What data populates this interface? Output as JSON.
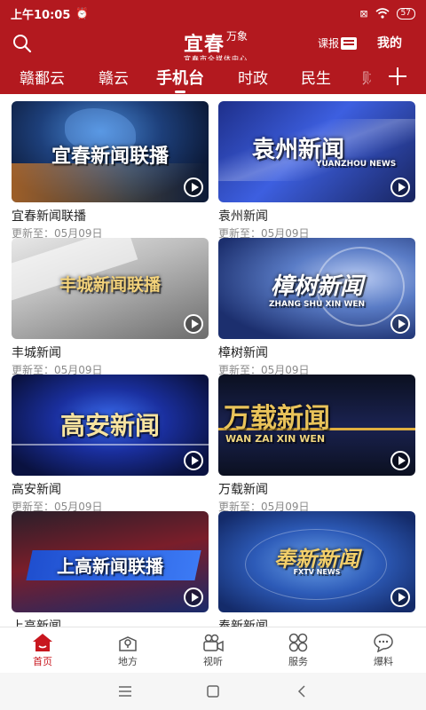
{
  "status": {
    "time": "上午10:05",
    "battery": "57"
  },
  "header": {
    "logo_main": "宜春",
    "logo_wanxiang": "万象",
    "logo_sub": "宜春市全媒体中心",
    "kebao_label": "课报",
    "mine_label": "我的"
  },
  "tabs": [
    {
      "label": "赣鄱云"
    },
    {
      "label": "赣云"
    },
    {
      "label": "手机台",
      "active": true
    },
    {
      "label": "时政"
    },
    {
      "label": "民生"
    },
    {
      "label": "财"
    }
  ],
  "programs": [
    {
      "name": "宜春新闻联播",
      "updated": "更新至：05月09日",
      "thumb_text": "宜春新闻联播",
      "thumb_sub": ""
    },
    {
      "name": "袁州新闻",
      "updated": "更新至：05月09日",
      "thumb_text": "袁州新闻",
      "thumb_sub": "YUANZHOU NEWS"
    },
    {
      "name": "丰城新闻",
      "updated": "更新至：05月09日",
      "thumb_text": "丰城新闻联播",
      "thumb_sub": ""
    },
    {
      "name": "樟树新闻",
      "updated": "更新至：05月09日",
      "thumb_text": "樟树新闻",
      "thumb_sub": "ZHANG SHU XIN WEN"
    },
    {
      "name": "高安新闻",
      "updated": "更新至：05月09日",
      "thumb_text": "高安新闻",
      "thumb_sub": ""
    },
    {
      "name": "万载新闻",
      "updated": "更新至：05月09日",
      "thumb_text": "万载新闻",
      "thumb_sub": "WAN ZAI XIN WEN"
    },
    {
      "name": "上高新闻",
      "updated": "",
      "thumb_text": "上高新闻联播",
      "thumb_sub": ""
    },
    {
      "name": "奉新新闻",
      "updated": "",
      "thumb_text": "奉新新闻",
      "thumb_sub": "FXTV NEWS"
    }
  ],
  "bottom_nav": [
    {
      "label": "首页",
      "icon": "home-icon",
      "active": true
    },
    {
      "label": "地方",
      "icon": "location-icon"
    },
    {
      "label": "视听",
      "icon": "video-camera-icon"
    },
    {
      "label": "服务",
      "icon": "services-icon"
    },
    {
      "label": "爆料",
      "icon": "chat-icon"
    }
  ],
  "colors": {
    "brand_red": "#b3191f",
    "active_nav": "#c8161e"
  }
}
